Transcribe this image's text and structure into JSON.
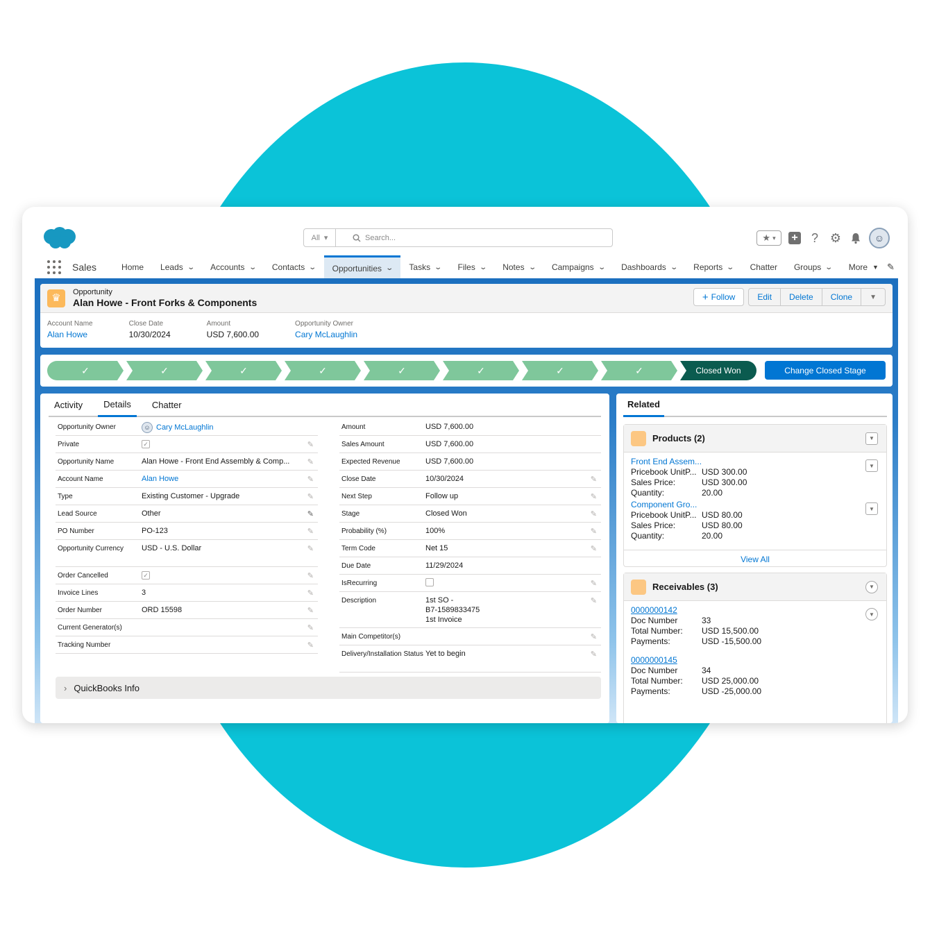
{
  "header": {
    "search_scope": "All",
    "search_placeholder": "Search..."
  },
  "nav": {
    "app_name": "Sales",
    "items": [
      {
        "label": "Home",
        "menu": false
      },
      {
        "label": "Leads",
        "menu": true
      },
      {
        "label": "Accounts",
        "menu": true
      },
      {
        "label": "Contacts",
        "menu": true
      },
      {
        "label": "Opportunities",
        "menu": true,
        "active": true
      },
      {
        "label": "Tasks",
        "menu": true
      },
      {
        "label": "Files",
        "menu": true
      },
      {
        "label": "Notes",
        "menu": true
      },
      {
        "label": "Campaigns",
        "menu": true
      },
      {
        "label": "Dashboards",
        "menu": true
      },
      {
        "label": "Reports",
        "menu": true
      },
      {
        "label": "Chatter",
        "menu": false
      },
      {
        "label": "Groups",
        "menu": true
      }
    ],
    "more_label": "More"
  },
  "record": {
    "type_label": "Opportunity",
    "title": "Alan Howe - Front Forks & Components",
    "buttons": {
      "follow": "Follow",
      "edit": "Edit",
      "delete": "Delete",
      "clone": "Clone"
    },
    "highlights": [
      {
        "label": "Account Name",
        "value": "Alan Howe",
        "link": true
      },
      {
        "label": "Close Date",
        "value": "10/30/2024",
        "link": false
      },
      {
        "label": "Amount",
        "value": "USD 7,600.00",
        "link": false
      },
      {
        "label": "Opportunity Owner",
        "value": "Cary McLaughlin",
        "link": true
      }
    ]
  },
  "path": {
    "completed_steps": 8,
    "current_stage": "Closed Won",
    "change_button": "Change Closed Stage"
  },
  "tabs": {
    "items": [
      "Activity",
      "Details",
      "Chatter"
    ],
    "active": "Details"
  },
  "details": {
    "left": [
      {
        "label": "Opportunity Owner",
        "value": "Cary McLaughlin",
        "kind": "owner"
      },
      {
        "label": "Private",
        "value": "",
        "kind": "checkbox",
        "checked": true
      },
      {
        "label": "Opportunity Name",
        "value": "Alan Howe - Front End Assembly & Comp...",
        "kind": "text"
      },
      {
        "label": "Account Name",
        "value": "Alan Howe",
        "kind": "link"
      },
      {
        "label": "Type",
        "value": "Existing Customer - Upgrade",
        "kind": "text"
      },
      {
        "label": "Lead Source",
        "value": "Other",
        "kind": "text"
      },
      {
        "label": "PO Number",
        "value": "PO-123",
        "kind": "text"
      },
      {
        "label": "Opportunity Currency",
        "value": "USD - U.S. Dollar",
        "kind": "text",
        "tall": true
      },
      {
        "label": "Order Cancelled",
        "value": "",
        "kind": "checkbox",
        "checked": true
      },
      {
        "label": "Invoice Lines",
        "value": "3",
        "kind": "text"
      },
      {
        "label": "Order Number",
        "value": "ORD 15598",
        "kind": "text"
      },
      {
        "label": "Current Generator(s)",
        "value": "",
        "kind": "text"
      },
      {
        "label": "Tracking Number",
        "value": "",
        "kind": "text"
      }
    ],
    "right": [
      {
        "label": "Amount",
        "value": "USD 7,600.00",
        "kind": "text",
        "noedit": true
      },
      {
        "label": "Sales Amount",
        "value": "USD 7,600.00",
        "kind": "text",
        "noedit": true
      },
      {
        "label": "Expected Revenue",
        "value": "USD 7,600.00",
        "kind": "text",
        "noedit": true
      },
      {
        "label": "Close Date",
        "value": "10/30/2024",
        "kind": "text"
      },
      {
        "label": "Next Step",
        "value": "Follow up",
        "kind": "text"
      },
      {
        "label": "Stage",
        "value": "Closed Won",
        "kind": "text"
      },
      {
        "label": "Probability (%)",
        "value": "100%",
        "kind": "text"
      },
      {
        "label": "Term Code",
        "value": "Net 15",
        "kind": "text"
      },
      {
        "label": "Due Date",
        "value": "11/29/2024",
        "kind": "text",
        "noedit": true
      },
      {
        "label": "IsRecurring",
        "value": "",
        "kind": "checkbox",
        "checked": false
      },
      {
        "label": "Description",
        "value": "1st SO -\nB7-1589833475\n1st Invoice",
        "kind": "multiline"
      },
      {
        "label": "Main Competitor(s)",
        "value": "",
        "kind": "text"
      },
      {
        "label": "Delivery/Installation Status",
        "value": "Yet to begin",
        "kind": "text",
        "tall": true
      }
    ],
    "section_label": "QuickBooks Info"
  },
  "related": {
    "tab_label": "Related",
    "products": {
      "title": "Products (2)",
      "items": [
        {
          "name": "Front End Assem...",
          "fields": [
            [
              "Pricebook UnitP...",
              "USD 300.00"
            ],
            [
              "Sales Price:",
              "USD 300.00"
            ],
            [
              "Quantity:",
              "20.00"
            ]
          ]
        },
        {
          "name": "Component Gro...",
          "fields": [
            [
              "Pricebook UnitP...",
              "USD 80.00"
            ],
            [
              "Sales Price:",
              "USD 80.00"
            ],
            [
              "Quantity:",
              "20.00"
            ]
          ]
        }
      ],
      "view_all": "View All"
    },
    "receivables": {
      "title": "Receivables (3)",
      "items": [
        {
          "name": "0000000142",
          "fields": [
            [
              "Doc Number",
              "33"
            ],
            [
              "Total Number:",
              "USD 15,500.00"
            ],
            [
              "Payments:",
              "USD -15,500.00"
            ]
          ]
        },
        {
          "name": "0000000145",
          "fields": [
            [
              "Doc Number",
              "34"
            ],
            [
              "Total Number:",
              "USD 25,000.00"
            ],
            [
              "Payments:",
              "USD -25,000.00"
            ]
          ]
        }
      ]
    }
  }
}
